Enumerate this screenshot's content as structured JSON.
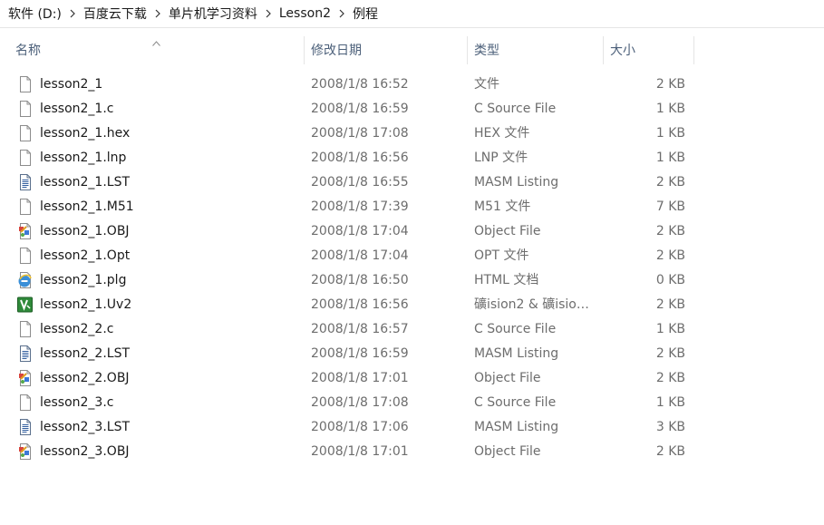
{
  "breadcrumb": [
    "软件 (D:)",
    "百度云下载",
    "单片机学习资料",
    "Lesson2",
    "例程"
  ],
  "columns": {
    "name": "名称",
    "date": "修改日期",
    "type": "类型",
    "size": "大小"
  },
  "files": [
    {
      "name": "lesson2_1",
      "date": "2008/1/8 16:52",
      "type": "文件",
      "size": "2 KB",
      "icon": "generic-file-icon"
    },
    {
      "name": "lesson2_1.c",
      "date": "2008/1/8 16:59",
      "type": "C Source File",
      "size": "1 KB",
      "icon": "generic-file-icon"
    },
    {
      "name": "lesson2_1.hex",
      "date": "2008/1/8 17:08",
      "type": "HEX 文件",
      "size": "1 KB",
      "icon": "generic-file-icon"
    },
    {
      "name": "lesson2_1.lnp",
      "date": "2008/1/8 16:56",
      "type": "LNP 文件",
      "size": "1 KB",
      "icon": "generic-file-icon"
    },
    {
      "name": "lesson2_1.LST",
      "date": "2008/1/8 16:55",
      "type": "MASM Listing",
      "size": "2 KB",
      "icon": "text-file-icon"
    },
    {
      "name": "lesson2_1.M51",
      "date": "2008/1/8 17:39",
      "type": "M51 文件",
      "size": "7 KB",
      "icon": "generic-file-icon"
    },
    {
      "name": "lesson2_1.OBJ",
      "date": "2008/1/8 17:04",
      "type": "Object File",
      "size": "2 KB",
      "icon": "object-file-icon"
    },
    {
      "name": "lesson2_1.Opt",
      "date": "2008/1/8 17:04",
      "type": "OPT 文件",
      "size": "2 KB",
      "icon": "generic-file-icon"
    },
    {
      "name": "lesson2_1.plg",
      "date": "2008/1/8 16:50",
      "type": "HTML 文档",
      "size": "0 KB",
      "icon": "html-file-icon"
    },
    {
      "name": "lesson2_1.Uv2",
      "date": "2008/1/8 16:56",
      "type": "礦ision2 & 礦isio…",
      "size": "2 KB",
      "icon": "uvision-file-icon"
    },
    {
      "name": "lesson2_2.c",
      "date": "2008/1/8 16:57",
      "type": "C Source File",
      "size": "1 KB",
      "icon": "generic-file-icon"
    },
    {
      "name": "lesson2_2.LST",
      "date": "2008/1/8 16:59",
      "type": "MASM Listing",
      "size": "2 KB",
      "icon": "text-file-icon"
    },
    {
      "name": "lesson2_2.OBJ",
      "date": "2008/1/8 17:01",
      "type": "Object File",
      "size": "2 KB",
      "icon": "object-file-icon"
    },
    {
      "name": "lesson2_3.c",
      "date": "2008/1/8 17:08",
      "type": "C Source File",
      "size": "1 KB",
      "icon": "generic-file-icon"
    },
    {
      "name": "lesson2_3.LST",
      "date": "2008/1/8 17:06",
      "type": "MASM Listing",
      "size": "3 KB",
      "icon": "text-file-icon"
    },
    {
      "name": "lesson2_3.OBJ",
      "date": "2008/1/8 17:01",
      "type": "Object File",
      "size": "2 KB",
      "icon": "object-file-icon"
    }
  ],
  "colors": {
    "header_text": "#4c607a",
    "secondary_text": "#6d6d6d",
    "divider": "#e5e5e5"
  }
}
